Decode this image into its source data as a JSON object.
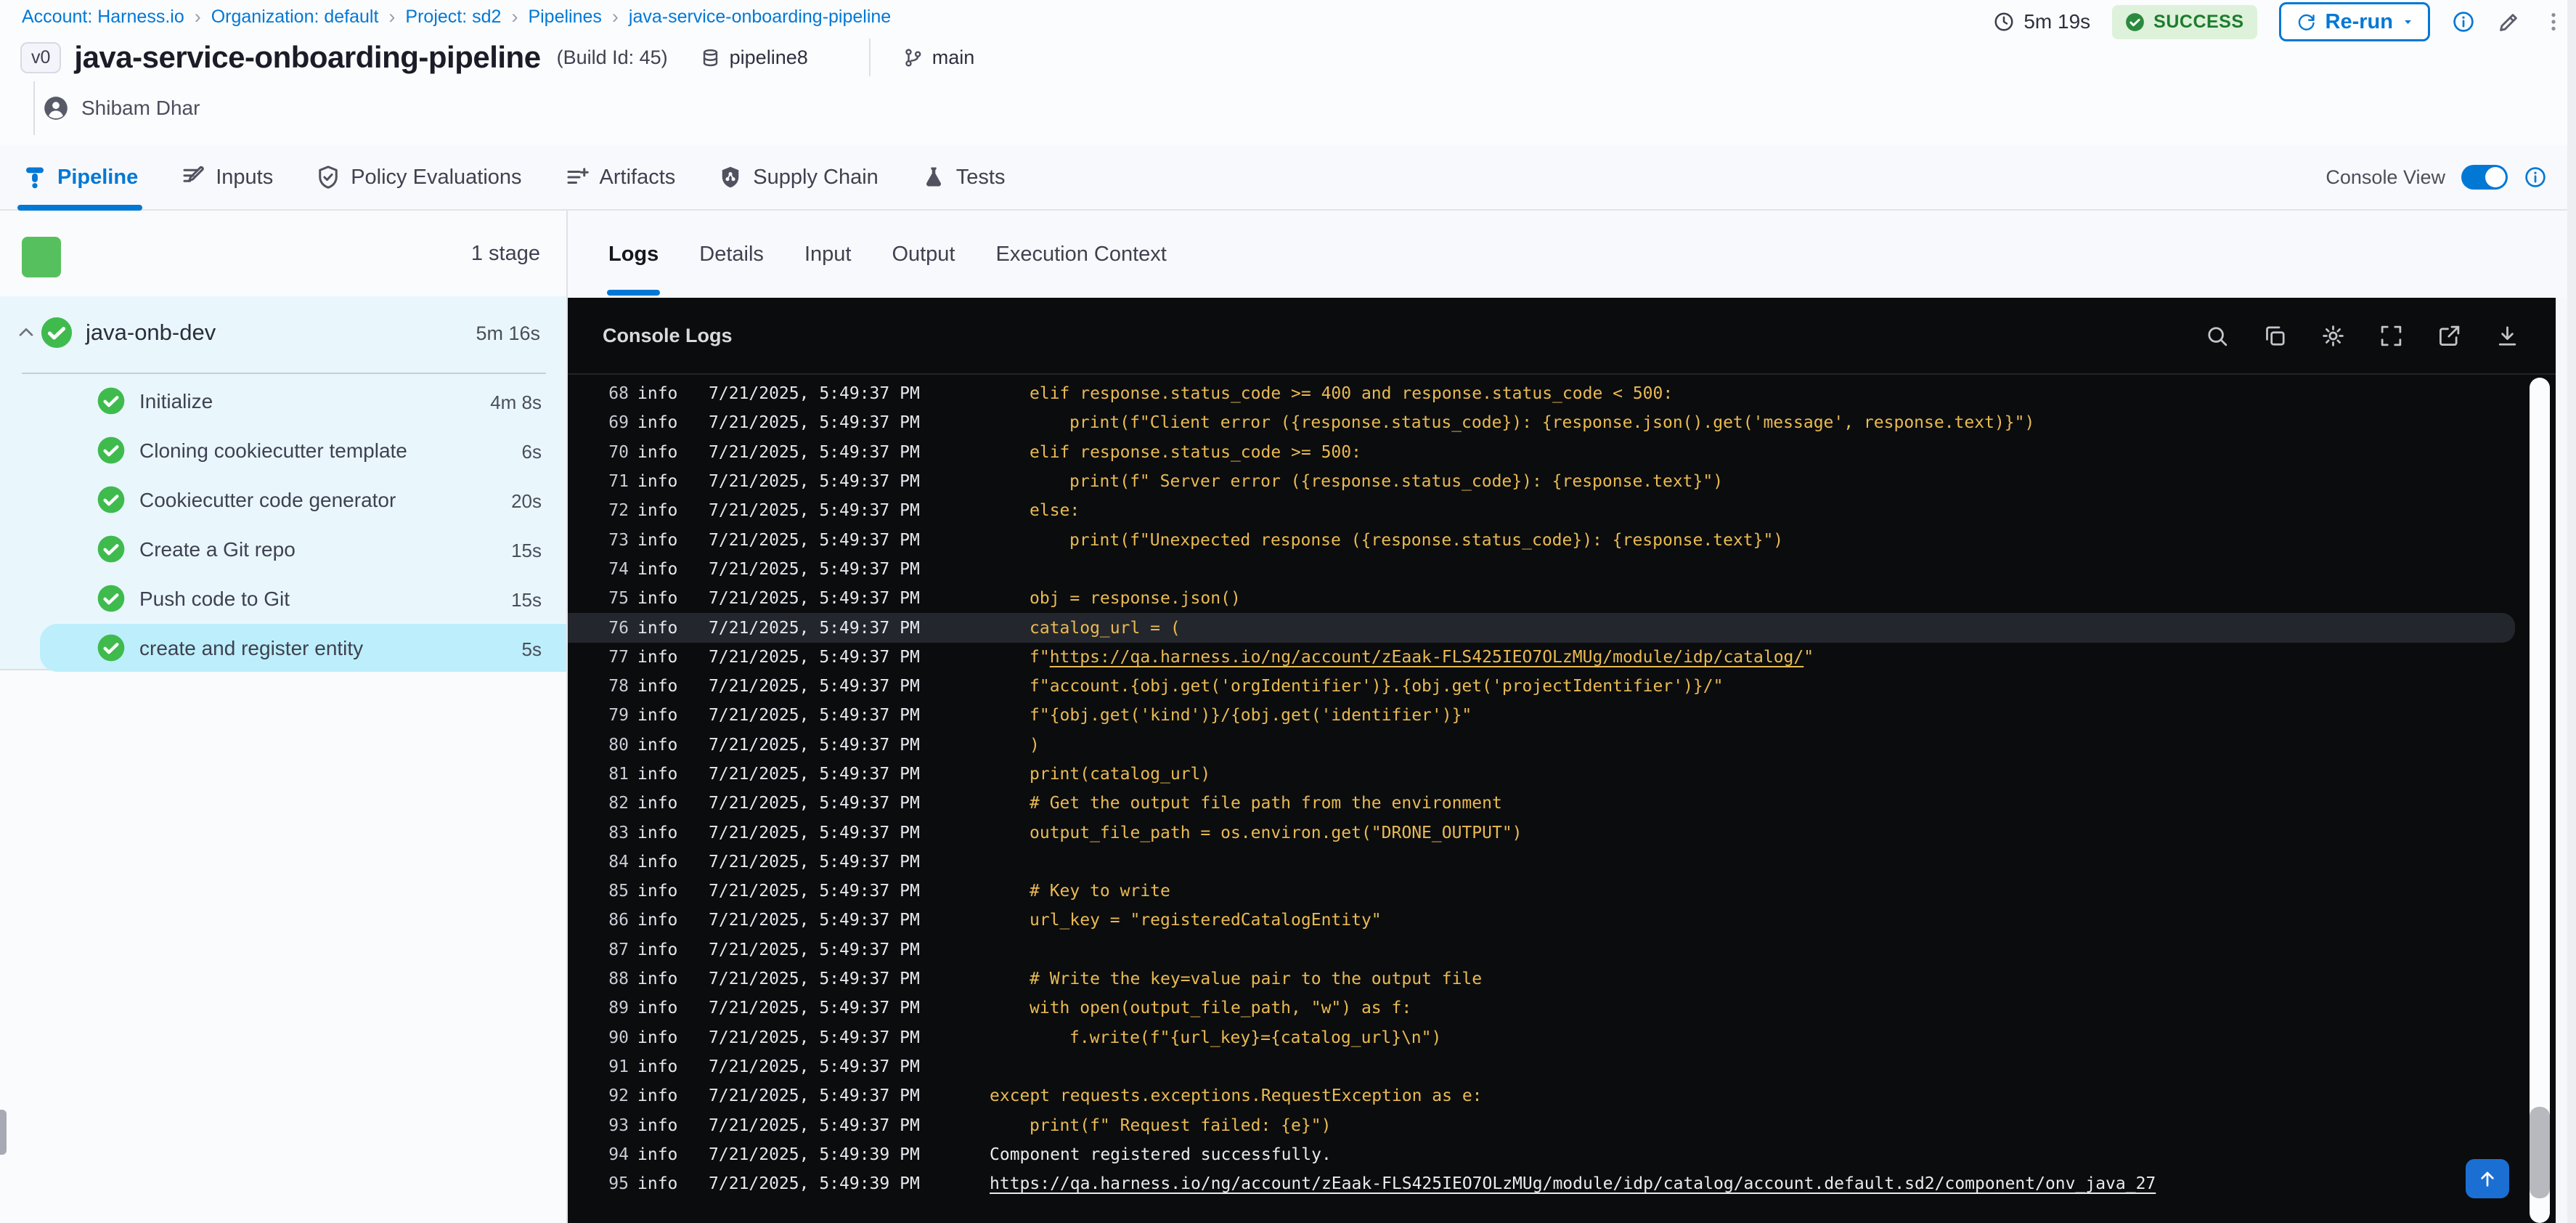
{
  "colors": {
    "accent": "#0278d5",
    "success-dark": "#1c7d2e",
    "check-green": "#3fbb4e",
    "stage-green": "#57c05e",
    "sidebar-blue": "#e9f7fd",
    "selected-blue": "#bdeefb",
    "console-bg": "#0b0c0e",
    "log-yellow": "#e9ba52"
  },
  "breadcrumb": {
    "items": [
      "Account: Harness.io",
      "Organization: default",
      "Project: sd2",
      "Pipelines",
      "java-service-onboarding-pipeline"
    ]
  },
  "header": {
    "version_badge": "v0",
    "title": "java-service-onboarding-pipeline",
    "build_id": "(Build Id: 45)",
    "pipeline_tag": "pipeline8",
    "branch": "main",
    "user": "Shibam Dhar",
    "duration": "5m 19s",
    "status": "SUCCESS",
    "rerun_label": "Re-run"
  },
  "tabs": [
    {
      "label": "Pipeline",
      "icon": "pipeline",
      "active": true
    },
    {
      "label": "Inputs",
      "icon": "inputs",
      "active": false
    },
    {
      "label": "Policy Evaluations",
      "icon": "shield-check",
      "active": false
    },
    {
      "label": "Artifacts",
      "icon": "list-plus",
      "active": false
    },
    {
      "label": "Supply Chain",
      "icon": "shield-nodes",
      "active": false
    },
    {
      "label": "Tests",
      "icon": "flask",
      "active": false
    }
  ],
  "console_view": {
    "label": "Console View",
    "enabled": true
  },
  "sidebar": {
    "stage_count": "1 stage",
    "stage": {
      "name": "java-onb-dev",
      "duration": "5m 16s"
    },
    "steps": [
      {
        "label": "Initialize",
        "duration": "4m 8s",
        "selected": false
      },
      {
        "label": "Cloning cookiecutter template",
        "duration": "6s",
        "selected": false
      },
      {
        "label": "Cookiecutter code generator",
        "duration": "20s",
        "selected": false
      },
      {
        "label": "Create a Git repo",
        "duration": "15s",
        "selected": false
      },
      {
        "label": "Push code to Git",
        "duration": "15s",
        "selected": false
      },
      {
        "label": "create and register entity",
        "duration": "5s",
        "selected": true
      }
    ]
  },
  "log_panel": {
    "tabs": [
      "Logs",
      "Details",
      "Input",
      "Output",
      "Execution Context"
    ],
    "active_tab": "Logs"
  },
  "console": {
    "title": "Console Logs",
    "icons": [
      "search",
      "copy",
      "gear",
      "fullscreen",
      "open-new",
      "download"
    ],
    "lines": [
      {
        "n": 68,
        "lv": "info",
        "ts": "7/21/2025, 5:49:37 PM",
        "ind": 1,
        "c": "y",
        "parts": [
          {
            "t": "elif response.status_code >= 400 and response.status_code < 500:"
          }
        ]
      },
      {
        "n": 69,
        "lv": "info",
        "ts": "7/21/2025, 5:49:37 PM",
        "ind": 2,
        "c": "y",
        "parts": [
          {
            "t": "print(f\"Client error ({response.status_code}): {response.json().get('message', response.text)}\")"
          }
        ]
      },
      {
        "n": 70,
        "lv": "info",
        "ts": "7/21/2025, 5:49:37 PM",
        "ind": 1,
        "c": "y",
        "parts": [
          {
            "t": "elif response.status_code >= 500:"
          }
        ]
      },
      {
        "n": 71,
        "lv": "info",
        "ts": "7/21/2025, 5:49:37 PM",
        "ind": 2,
        "c": "y",
        "parts": [
          {
            "t": "print(f\" Server error ({response.status_code}): {response.text}\")"
          }
        ]
      },
      {
        "n": 72,
        "lv": "info",
        "ts": "7/21/2025, 5:49:37 PM",
        "ind": 1,
        "c": "y",
        "parts": [
          {
            "t": "else:"
          }
        ]
      },
      {
        "n": 73,
        "lv": "info",
        "ts": "7/21/2025, 5:49:37 PM",
        "ind": 2,
        "c": "y",
        "parts": [
          {
            "t": "print(f\"Unexpected response ({response.status_code}): {response.text}\")"
          }
        ]
      },
      {
        "n": 74,
        "lv": "info",
        "ts": "7/21/2025, 5:49:37 PM",
        "ind": 0,
        "c": "y",
        "parts": []
      },
      {
        "n": 75,
        "lv": "info",
        "ts": "7/21/2025, 5:49:37 PM",
        "ind": 1,
        "c": "y",
        "parts": [
          {
            "t": "obj = response.json()"
          }
        ]
      },
      {
        "n": 76,
        "lv": "info",
        "ts": "7/21/2025, 5:49:37 PM",
        "ind": 1,
        "c": "y",
        "hl": true,
        "parts": [
          {
            "t": "catalog_url = ("
          }
        ]
      },
      {
        "n": 77,
        "lv": "info",
        "ts": "7/21/2025, 5:49:37 PM",
        "ind": 1,
        "c": "y",
        "parts": [
          {
            "t": "f\""
          },
          {
            "t": "https://qa.harness.io/ng/account/zEaak-FLS425IEO7OLzMUg/module/idp/catalog/",
            "u": true
          },
          {
            "t": "\""
          }
        ]
      },
      {
        "n": 78,
        "lv": "info",
        "ts": "7/21/2025, 5:49:37 PM",
        "ind": 1,
        "c": "y",
        "parts": [
          {
            "t": "f\"account.{obj.get('orgIdentifier')}.{obj.get('projectIdentifier')}/\""
          }
        ]
      },
      {
        "n": 79,
        "lv": "info",
        "ts": "7/21/2025, 5:49:37 PM",
        "ind": 1,
        "c": "y",
        "parts": [
          {
            "t": "f\"{obj.get('kind')}/{obj.get('identifier')}\""
          }
        ]
      },
      {
        "n": 80,
        "lv": "info",
        "ts": "7/21/2025, 5:49:37 PM",
        "ind": 1,
        "c": "y",
        "parts": [
          {
            "t": ")"
          }
        ]
      },
      {
        "n": 81,
        "lv": "info",
        "ts": "7/21/2025, 5:49:37 PM",
        "ind": 1,
        "c": "y",
        "parts": [
          {
            "t": "print(catalog_url)"
          }
        ]
      },
      {
        "n": 82,
        "lv": "info",
        "ts": "7/21/2025, 5:49:37 PM",
        "ind": 1,
        "c": "y",
        "parts": [
          {
            "t": "# Get the output file path from the environment"
          }
        ]
      },
      {
        "n": 83,
        "lv": "info",
        "ts": "7/21/2025, 5:49:37 PM",
        "ind": 1,
        "c": "y",
        "parts": [
          {
            "t": "output_file_path = os.environ.get(\"DRONE_OUTPUT\")"
          }
        ]
      },
      {
        "n": 84,
        "lv": "info",
        "ts": "7/21/2025, 5:49:37 PM",
        "ind": 0,
        "c": "y",
        "parts": []
      },
      {
        "n": 85,
        "lv": "info",
        "ts": "7/21/2025, 5:49:37 PM",
        "ind": 1,
        "c": "y",
        "parts": [
          {
            "t": "# Key to write"
          }
        ]
      },
      {
        "n": 86,
        "lv": "info",
        "ts": "7/21/2025, 5:49:37 PM",
        "ind": 1,
        "c": "y",
        "parts": [
          {
            "t": "url_key = \"registeredCatalogEntity\""
          }
        ]
      },
      {
        "n": 87,
        "lv": "info",
        "ts": "7/21/2025, 5:49:37 PM",
        "ind": 0,
        "c": "y",
        "parts": []
      },
      {
        "n": 88,
        "lv": "info",
        "ts": "7/21/2025, 5:49:37 PM",
        "ind": 1,
        "c": "y",
        "parts": [
          {
            "t": "# Write the key=value pair to the output file"
          }
        ]
      },
      {
        "n": 89,
        "lv": "info",
        "ts": "7/21/2025, 5:49:37 PM",
        "ind": 1,
        "c": "y",
        "parts": [
          {
            "t": "with open(output_file_path, \"w\") as f:"
          }
        ]
      },
      {
        "n": 90,
        "lv": "info",
        "ts": "7/21/2025, 5:49:37 PM",
        "ind": 2,
        "c": "y",
        "parts": [
          {
            "t": "f.write(f\"{url_key}={catalog_url}\\n\")"
          }
        ]
      },
      {
        "n": 91,
        "lv": "info",
        "ts": "7/21/2025, 5:49:37 PM",
        "ind": 0,
        "c": "y",
        "parts": []
      },
      {
        "n": 92,
        "lv": "info",
        "ts": "7/21/2025, 5:49:37 PM",
        "ind": 0,
        "c": "y",
        "parts": [
          {
            "t": "except requests.exceptions.RequestException as e:"
          }
        ]
      },
      {
        "n": 93,
        "lv": "info",
        "ts": "7/21/2025, 5:49:37 PM",
        "ind": 1,
        "c": "y",
        "parts": [
          {
            "t": "print(f\" Request failed: {e}\")"
          }
        ]
      },
      {
        "n": 94,
        "lv": "info",
        "ts": "7/21/2025, 5:49:39 PM",
        "ind": 0,
        "c": "w",
        "parts": [
          {
            "t": "Component registered successfully."
          }
        ]
      },
      {
        "n": 95,
        "lv": "info",
        "ts": "7/21/2025, 5:49:39 PM",
        "ind": 0,
        "c": "w",
        "parts": [
          {
            "t": "https://qa.harness.io/ng/account/zEaak-FLS425IEO7OLzMUg/module/idp/catalog/account.default.sd2/component/onv_java_27",
            "u": true
          }
        ]
      }
    ]
  }
}
